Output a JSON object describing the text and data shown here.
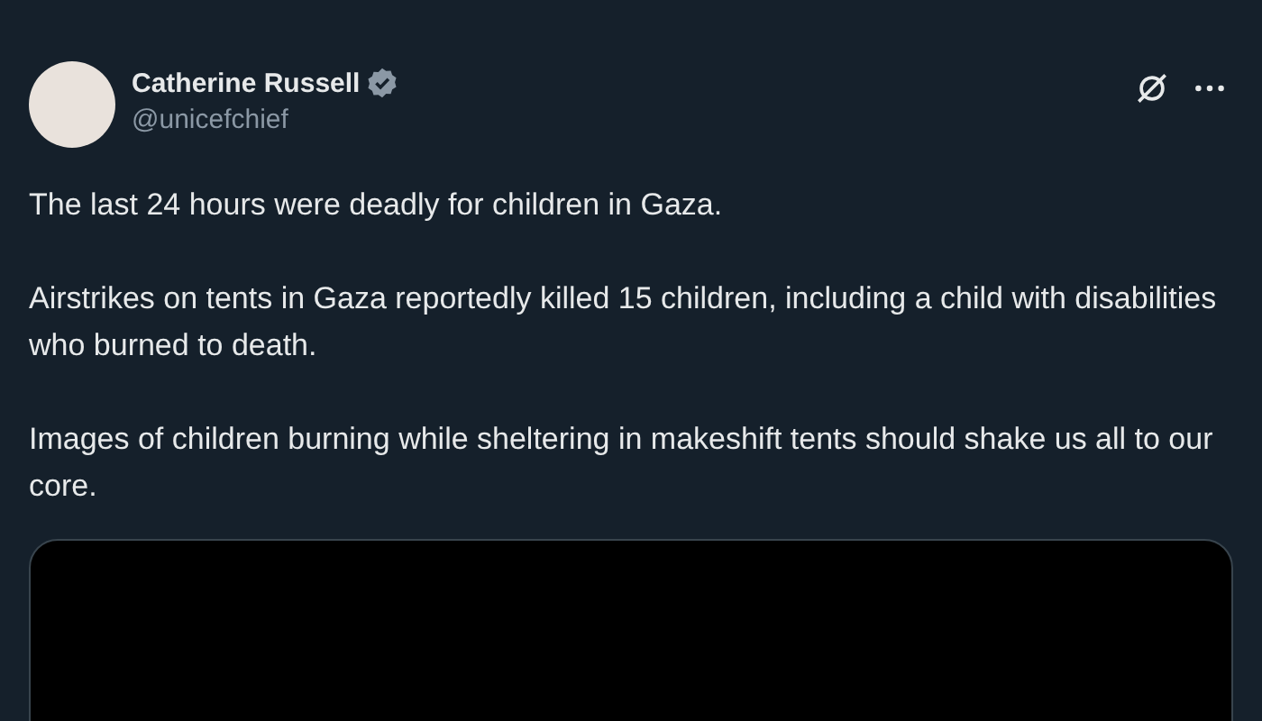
{
  "author": {
    "name": "Catherine Russell",
    "verified": true,
    "handle": "@unicefchief"
  },
  "paragraphs": [
    "The last 24 hours were deadly for children in Gaza.",
    "Airstrikes on tents in Gaza reportedly killed 15 children, including a child with disabilities who burned to death.",
    "Images of children burning while sheltering in makeshift tents should shake us all to our core."
  ]
}
